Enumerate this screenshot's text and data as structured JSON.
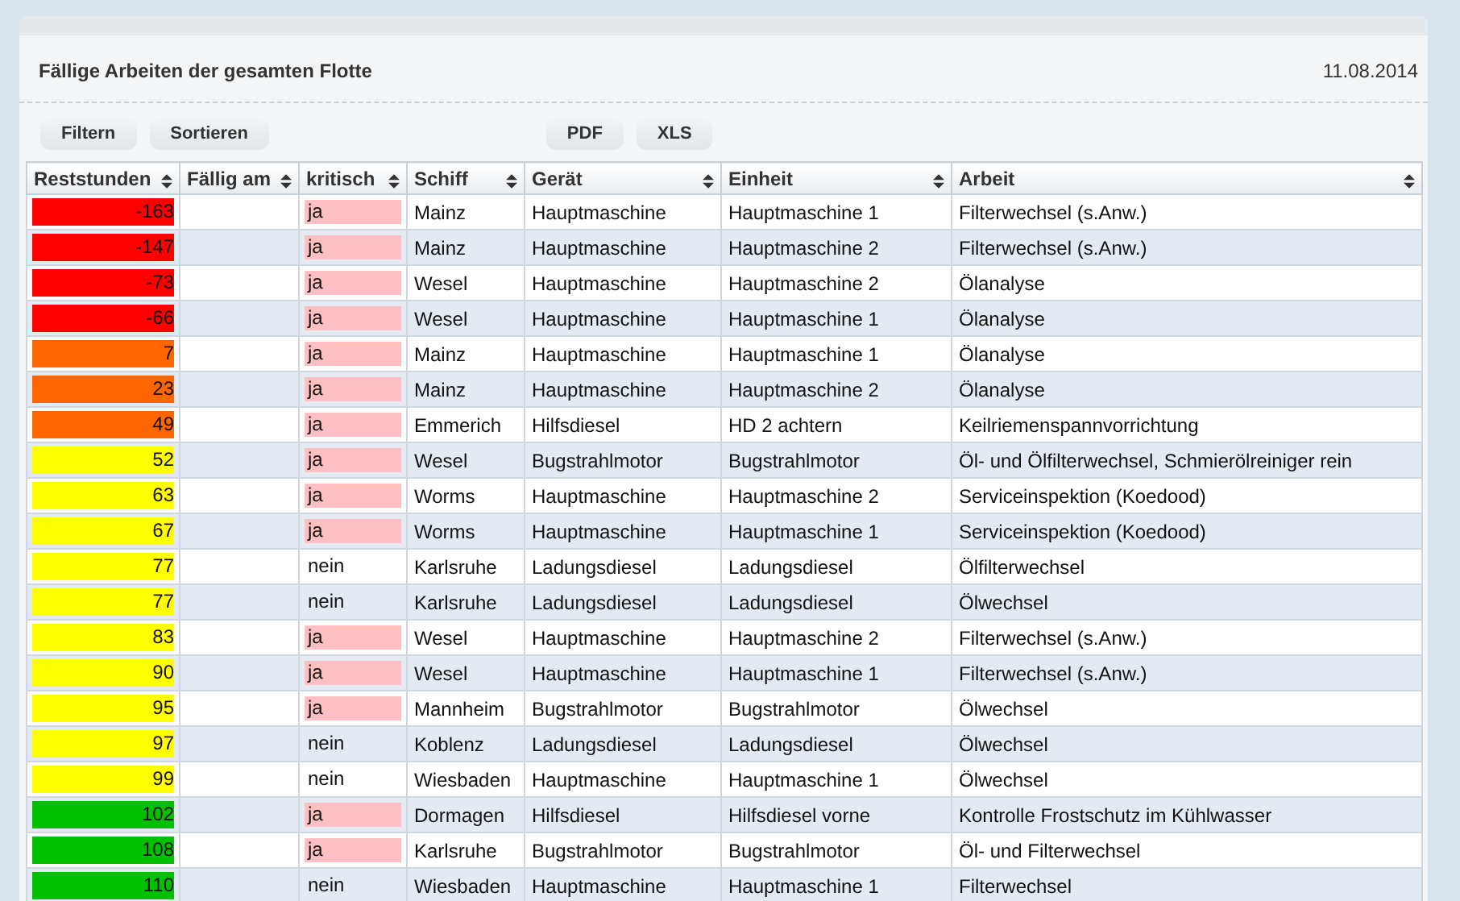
{
  "title": "Fällige Arbeiten der gesamten Flotte",
  "date": "11.08.2014",
  "toolbar_left": [
    "Filtern",
    "Sortieren"
  ],
  "toolbar_right": [
    "PDF",
    "XLS"
  ],
  "table": {
    "columns": [
      "Reststunden",
      "Fällig am",
      "kritisch",
      "Schiff",
      "Gerät",
      "Einheit",
      "Arbeit"
    ],
    "rows": [
      {
        "hours": "-163",
        "color": "#ff0000",
        "critical": true,
        "kritisch": "ja",
        "ship": "Mainz",
        "device": "Hauptmaschine",
        "unit": "Hauptmaschine 1",
        "work": "Filterwechsel (s.Anw.)"
      },
      {
        "hours": "-147",
        "color": "#ff0000",
        "critical": true,
        "kritisch": "ja",
        "ship": "Mainz",
        "device": "Hauptmaschine",
        "unit": "Hauptmaschine 2",
        "work": "Filterwechsel (s.Anw.)"
      },
      {
        "hours": "-73",
        "color": "#ff0000",
        "critical": true,
        "kritisch": "ja",
        "ship": "Wesel",
        "device": "Hauptmaschine",
        "unit": "Hauptmaschine 2",
        "work": "Ölanalyse"
      },
      {
        "hours": "-66",
        "color": "#ff0000",
        "critical": true,
        "kritisch": "ja",
        "ship": "Wesel",
        "device": "Hauptmaschine",
        "unit": "Hauptmaschine 1",
        "work": "Ölanalyse"
      },
      {
        "hours": "7",
        "color": "#ff6600",
        "critical": true,
        "kritisch": "ja",
        "ship": "Mainz",
        "device": "Hauptmaschine",
        "unit": "Hauptmaschine 1",
        "work": "Ölanalyse"
      },
      {
        "hours": "23",
        "color": "#ff6600",
        "critical": true,
        "kritisch": "ja",
        "ship": "Mainz",
        "device": "Hauptmaschine",
        "unit": "Hauptmaschine 2",
        "work": "Ölanalyse"
      },
      {
        "hours": "49",
        "color": "#ff6600",
        "critical": true,
        "kritisch": "ja",
        "ship": "Emmerich",
        "device": "Hilfsdiesel",
        "unit": "HD 2 achtern",
        "work": "Keilriemenspannvorrichtung"
      },
      {
        "hours": "52",
        "color": "#ffff00",
        "critical": true,
        "kritisch": "ja",
        "ship": "Wesel",
        "device": "Bugstrahlmotor",
        "unit": "Bugstrahlmotor",
        "work": "Öl- und Ölfilterwechsel, Schmierölreiniger rein"
      },
      {
        "hours": "63",
        "color": "#ffff00",
        "critical": true,
        "kritisch": "ja",
        "ship": "Worms",
        "device": "Hauptmaschine",
        "unit": "Hauptmaschine 2",
        "work": "Serviceinspektion (Koedood)"
      },
      {
        "hours": "67",
        "color": "#ffff00",
        "critical": true,
        "kritisch": "ja",
        "ship": "Worms",
        "device": "Hauptmaschine",
        "unit": "Hauptmaschine 1",
        "work": "Serviceinspektion (Koedood)"
      },
      {
        "hours": "77",
        "color": "#ffff00",
        "critical": false,
        "kritisch": "nein",
        "ship": "Karlsruhe",
        "device": "Ladungsdiesel",
        "unit": "Ladungsdiesel",
        "work": "Ölfilterwechsel"
      },
      {
        "hours": "77",
        "color": "#ffff00",
        "critical": false,
        "kritisch": "nein",
        "ship": "Karlsruhe",
        "device": "Ladungsdiesel",
        "unit": "Ladungsdiesel",
        "work": "Ölwechsel"
      },
      {
        "hours": "83",
        "color": "#ffff00",
        "critical": true,
        "kritisch": "ja",
        "ship": "Wesel",
        "device": "Hauptmaschine",
        "unit": "Hauptmaschine 2",
        "work": "Filterwechsel (s.Anw.)"
      },
      {
        "hours": "90",
        "color": "#ffff00",
        "critical": true,
        "kritisch": "ja",
        "ship": "Wesel",
        "device": "Hauptmaschine",
        "unit": "Hauptmaschine 1",
        "work": "Filterwechsel (s.Anw.)"
      },
      {
        "hours": "95",
        "color": "#ffff00",
        "critical": true,
        "kritisch": "ja",
        "ship": "Mannheim",
        "device": "Bugstrahlmotor",
        "unit": "Bugstrahlmotor",
        "work": "Ölwechsel"
      },
      {
        "hours": "97",
        "color": "#ffff00",
        "critical": false,
        "kritisch": "nein",
        "ship": "Koblenz",
        "device": "Ladungsdiesel",
        "unit": "Ladungsdiesel",
        "work": "Ölwechsel"
      },
      {
        "hours": "99",
        "color": "#ffff00",
        "critical": false,
        "kritisch": "nein",
        "ship": "Wiesbaden",
        "device": "Hauptmaschine",
        "unit": "Hauptmaschine 1",
        "work": "Ölwechsel"
      },
      {
        "hours": "102",
        "color": "#00c000",
        "critical": true,
        "kritisch": "ja",
        "ship": "Dormagen",
        "device": "Hilfsdiesel",
        "unit": "Hilfsdiesel vorne",
        "work": "Kontrolle Frostschutz im Kühlwasser"
      },
      {
        "hours": "108",
        "color": "#00c000",
        "critical": true,
        "kritisch": "ja",
        "ship": "Karlsruhe",
        "device": "Bugstrahlmotor",
        "unit": "Bugstrahlmotor",
        "work": "Öl- und Filterwechsel"
      },
      {
        "hours": "110",
        "color": "#00c000",
        "critical": false,
        "kritisch": "nein",
        "ship": "Wiesbaden",
        "device": "Hauptmaschine",
        "unit": "Hauptmaschine 1",
        "work": "Filterwechsel"
      }
    ]
  }
}
